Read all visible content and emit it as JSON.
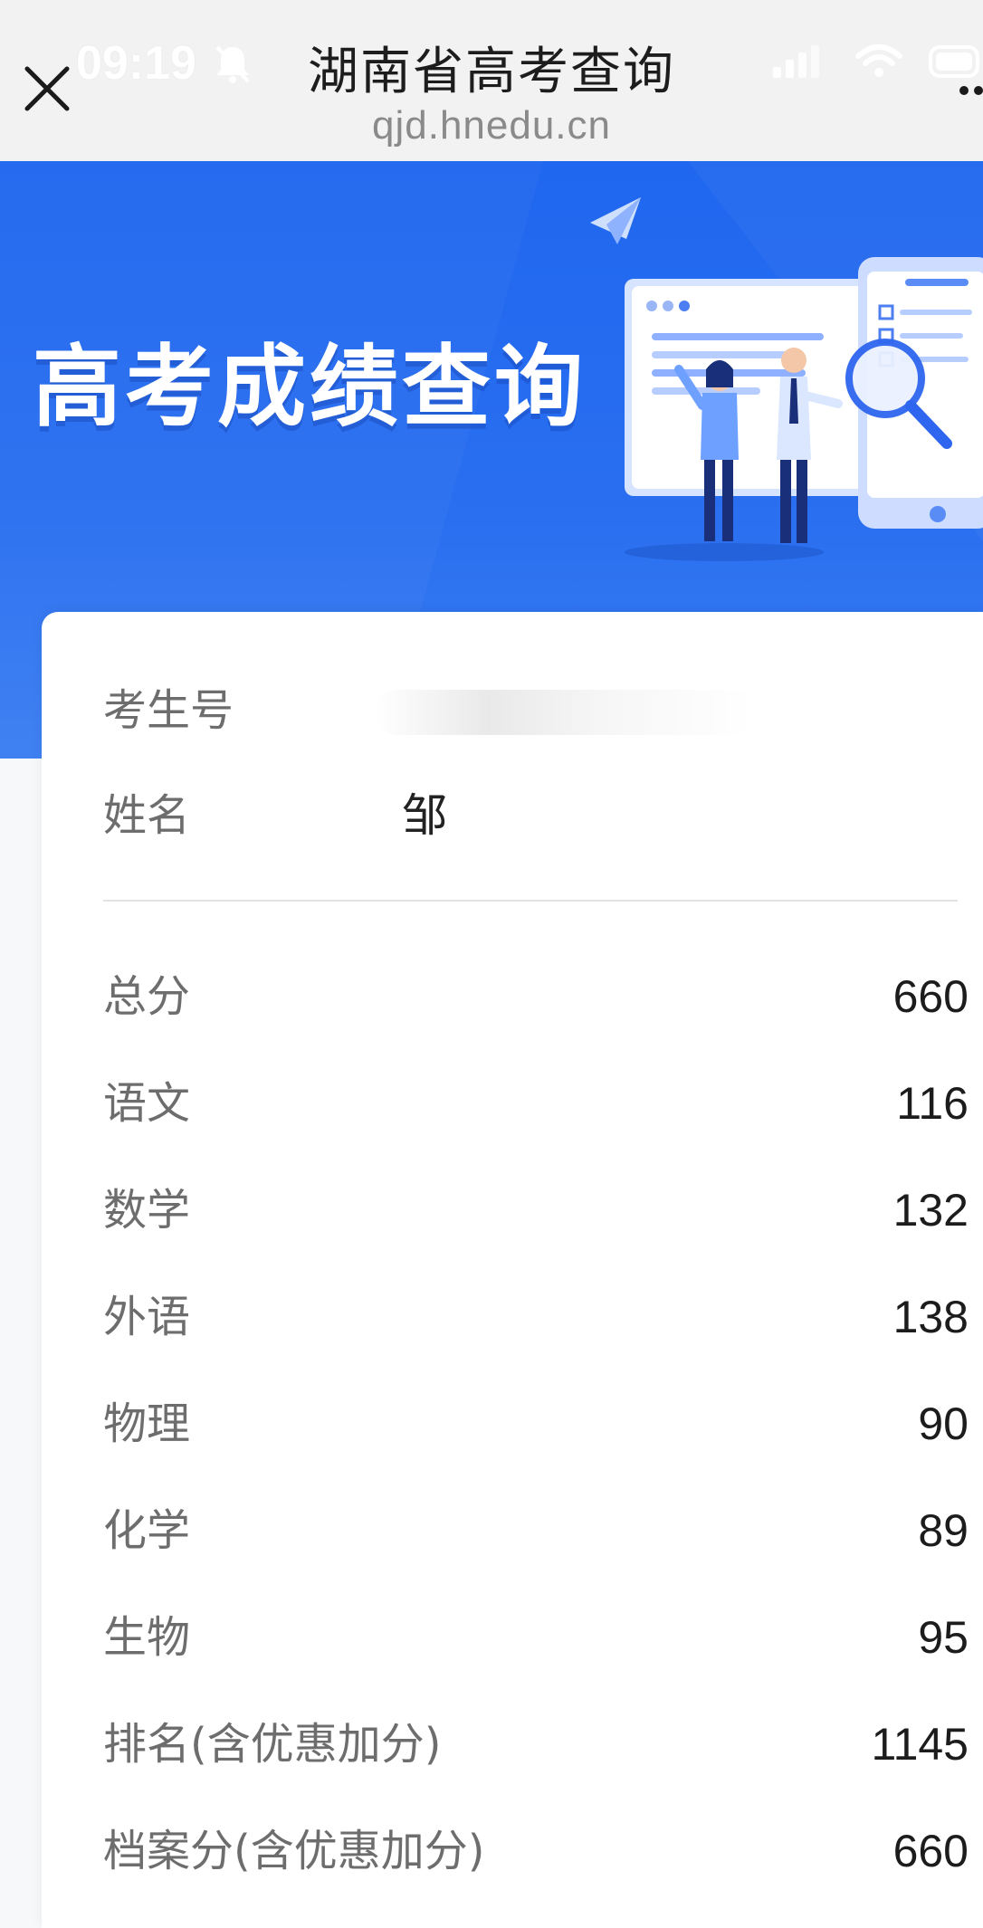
{
  "browser": {
    "title": "湖南省高考查询",
    "url": "qjd.hnedu.cn",
    "status_time": "09:19"
  },
  "hero": {
    "title": "高考成绩查询"
  },
  "student": {
    "exam_no_label": "考生号",
    "exam_no_value": "",
    "name_label": "姓名",
    "name_value": "邹"
  },
  "scores": [
    {
      "label": "总分",
      "value": "660"
    },
    {
      "label": "语文",
      "value": "116"
    },
    {
      "label": "数学",
      "value": "132"
    },
    {
      "label": "外语",
      "value": "138"
    },
    {
      "label": "物理",
      "value": "90"
    },
    {
      "label": "化学",
      "value": "89"
    },
    {
      "label": "生物",
      "value": "95"
    },
    {
      "label": "排名(含优惠加分)",
      "value": "1145"
    },
    {
      "label": "档案分(含优惠加分)",
      "value": "660"
    }
  ],
  "icons": {
    "close": "close-icon",
    "bell_off": "bell-off-icon",
    "signal": "signal-icon",
    "wifi": "wifi-icon",
    "battery": "battery-icon",
    "more": "more-icon"
  },
  "colors": {
    "hero_blue": "#1f67ef",
    "card_bg": "#ffffff",
    "label_gray": "#6d6d6d",
    "value_dark": "#1c1c1c"
  }
}
